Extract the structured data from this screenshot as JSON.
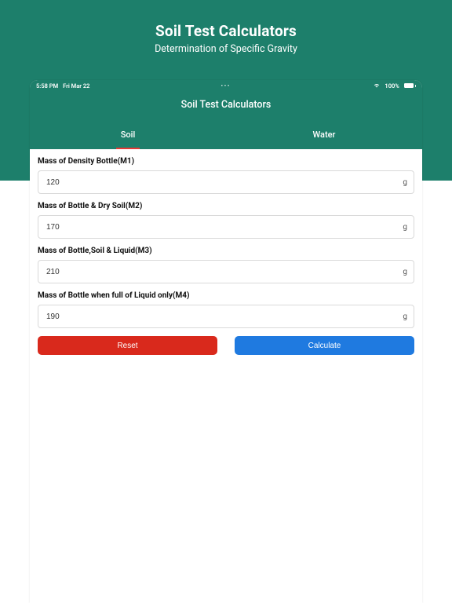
{
  "page_header": {
    "title": "Soil Test Calculators",
    "subtitle": "Determination of Specific Gravity"
  },
  "status_bar": {
    "time": "5:58 PM",
    "date": "Fri Mar 22",
    "battery_text": "100%"
  },
  "app": {
    "title": "Soil Test Calculators",
    "tabs": {
      "soil": "Soil",
      "water": "Water",
      "active": "soil"
    },
    "fields": [
      {
        "label": "Mass of Density Bottle(M1)",
        "value": "120",
        "unit": "g"
      },
      {
        "label": "Mass of Bottle & Dry Soil(M2)",
        "value": "170",
        "unit": "g"
      },
      {
        "label": "Mass of Bottle,Soil & Liquid(M3)",
        "value": "210",
        "unit": "g"
      },
      {
        "label": "Mass of Bottle when full of Liquid only(M4)",
        "value": "190",
        "unit": "g"
      }
    ],
    "buttons": {
      "reset": "Reset",
      "calculate": "Calculate"
    }
  }
}
